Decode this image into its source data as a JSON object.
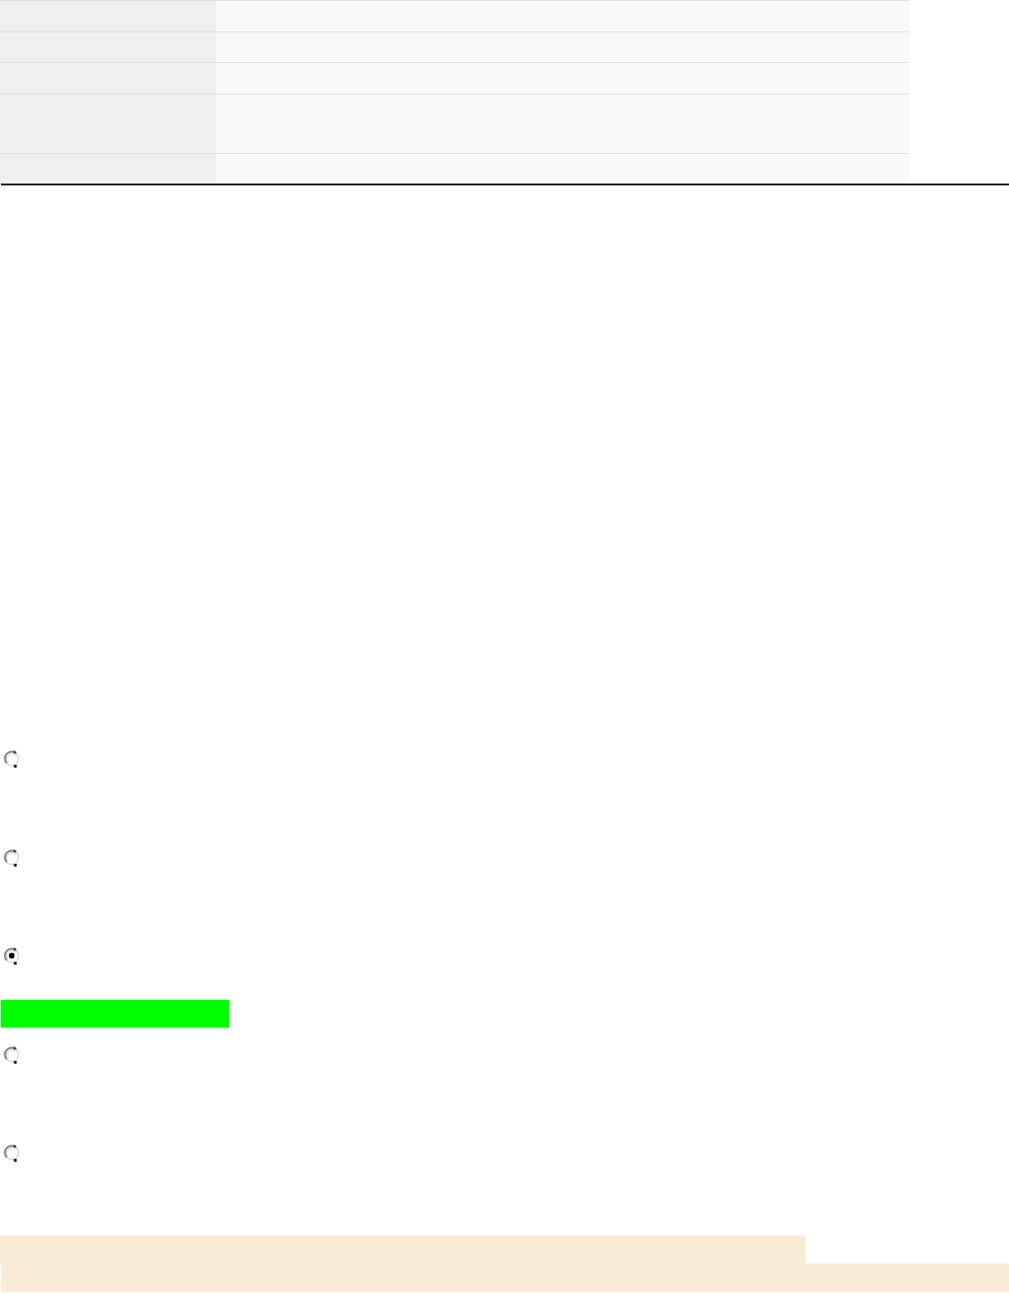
{
  "table": {
    "rows": [
      {
        "kind": "single"
      },
      {
        "kind": "single"
      },
      {
        "kind": "single"
      },
      {
        "kind": "double"
      },
      {
        "kind": "single"
      }
    ]
  },
  "options": [
    {
      "selected": false,
      "highlighted": false
    },
    {
      "selected": false,
      "highlighted": false
    },
    {
      "selected": true,
      "highlighted": true
    },
    {
      "selected": false,
      "highlighted": false
    },
    {
      "selected": false,
      "highlighted": false
    }
  ]
}
